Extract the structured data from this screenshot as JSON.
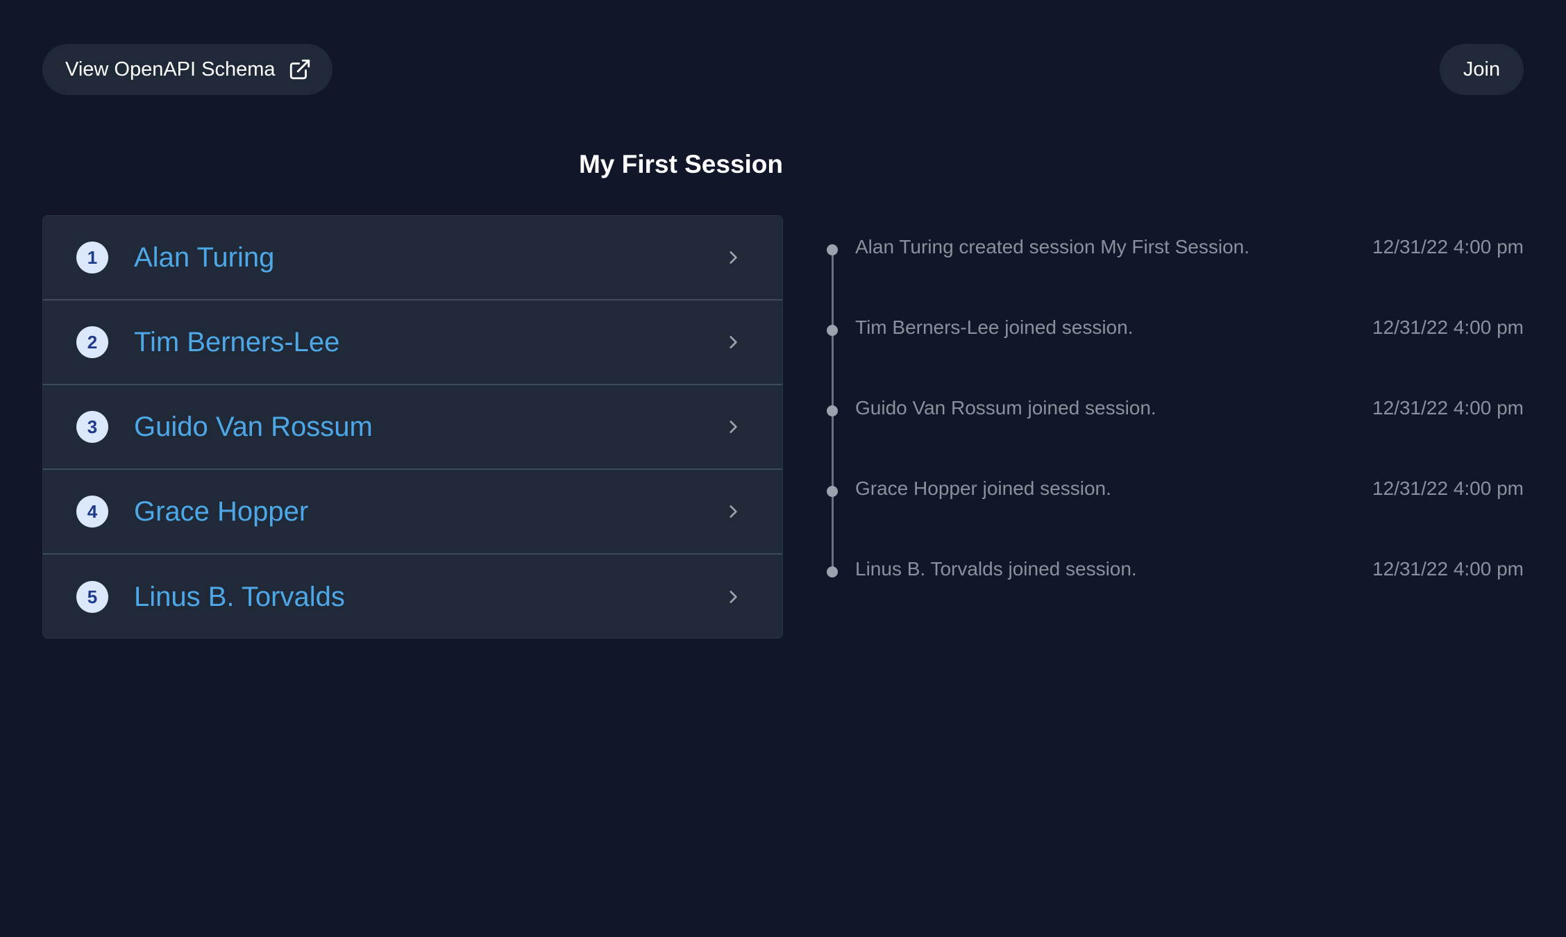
{
  "header": {
    "schema_button_label": "View OpenAPI Schema",
    "schema_button_icon": "external-link-icon",
    "join_button_label": "Join"
  },
  "session": {
    "title": "My First Session"
  },
  "participants": [
    {
      "rank": "1",
      "name": "Alan Turing"
    },
    {
      "rank": "2",
      "name": "Tim Berners-Lee"
    },
    {
      "rank": "3",
      "name": "Guido Van Rossum"
    },
    {
      "rank": "4",
      "name": "Grace Hopper"
    },
    {
      "rank": "5",
      "name": "Linus B. Torvalds"
    }
  ],
  "timeline": [
    {
      "text": "Alan Turing created session My First Session.",
      "time": "12/31/22 4:00 pm"
    },
    {
      "text": "Tim Berners-Lee joined session.",
      "time": "12/31/22 4:00 pm"
    },
    {
      "text": "Guido Van Rossum joined session.",
      "time": "12/31/22 4:00 pm"
    },
    {
      "text": "Grace Hopper joined session.",
      "time": "12/31/22 4:00 pm"
    },
    {
      "text": "Linus B. Torvalds joined session.",
      "time": "12/31/22 4:00 pm"
    }
  ],
  "colors": {
    "background": "#111729",
    "panel": "#1f2937",
    "accent_name": "#4ea8e8",
    "badge_bg": "#dbe7fb",
    "badge_text": "#1e3a8a",
    "muted_text": "#8a919c"
  }
}
